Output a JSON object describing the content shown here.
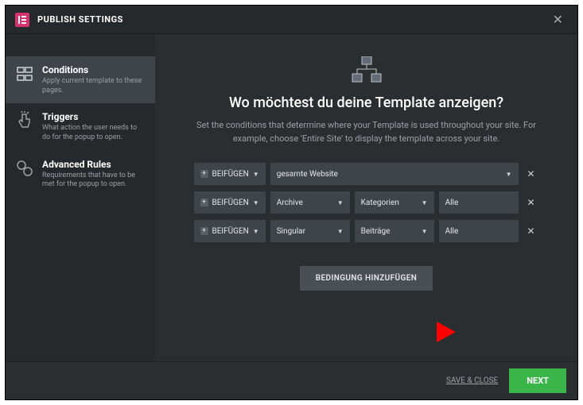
{
  "header": {
    "title": "PUBLISH SETTINGS"
  },
  "sidebar": {
    "items": [
      {
        "title": "Conditions",
        "desc": "Apply current template to these pages."
      },
      {
        "title": "Triggers",
        "desc": "What action the user needs to do for the popup to open."
      },
      {
        "title": "Advanced Rules",
        "desc": "Requirements that have to be met for the popup to open."
      }
    ]
  },
  "main": {
    "heading": "Wo möchtest du deine Template anzeigen?",
    "subtext": "Set the conditions that determine where your Template is used throughout your site. For example, choose 'Entire Site' to display the template across your site.",
    "include_label": "BEIFÜGEN",
    "rows": [
      {
        "selects": [
          "gesamte Website"
        ]
      },
      {
        "selects": [
          "Archive",
          "Kategorien",
          "Alle"
        ]
      },
      {
        "selects": [
          "Singular",
          "Beiträge",
          "Alle"
        ]
      }
    ],
    "add_button": "BEDINGUNG HINZUFÜGEN"
  },
  "footer": {
    "save_close": "SAVE & CLOSE",
    "next": "NEXT"
  }
}
